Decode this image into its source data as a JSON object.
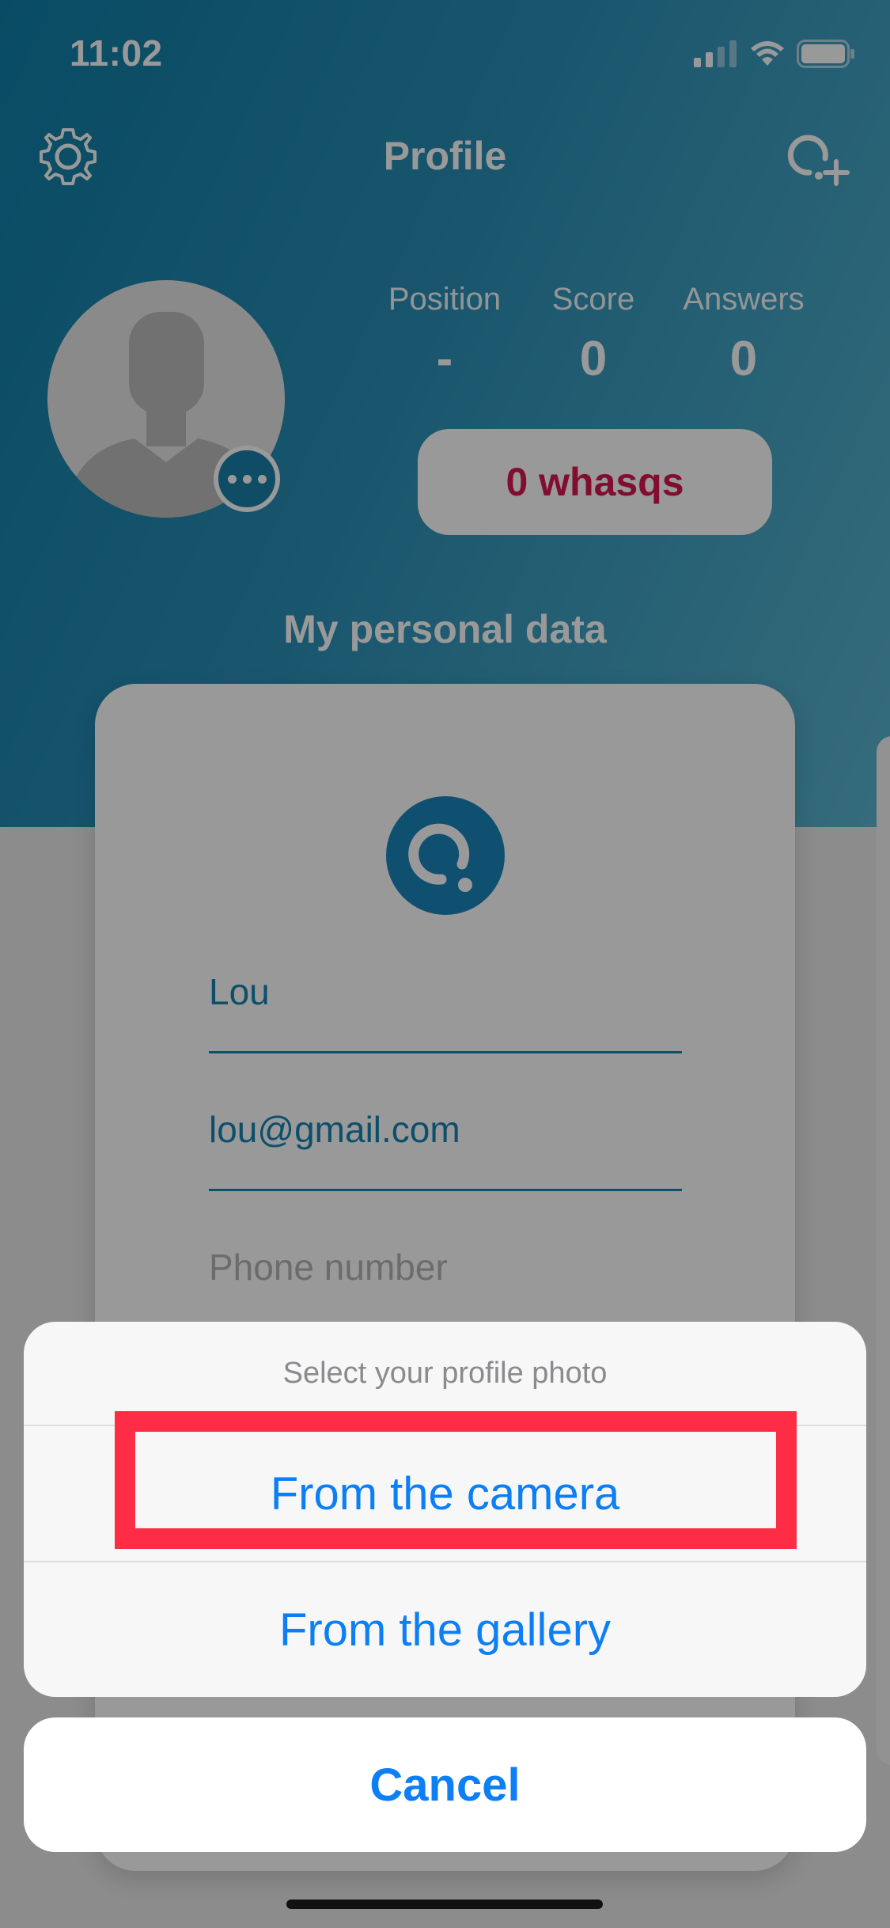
{
  "status_bar": {
    "time": "11:02"
  },
  "nav": {
    "title": "Profile",
    "settings_icon": "gear-icon",
    "add_icon": "add-question-icon"
  },
  "stats": [
    {
      "label": "Position",
      "value": "-"
    },
    {
      "label": "Score",
      "value": "0"
    },
    {
      "label": "Answers",
      "value": "0"
    }
  ],
  "whasqs_label": "0 whasqs",
  "section_title": "My personal data",
  "form": {
    "name_value": "Lou",
    "email_value": "lou@gmail.com",
    "phone_placeholder": "Phone number"
  },
  "action_sheet": {
    "title": "Select your profile photo",
    "options": [
      "From the camera",
      "From the gallery"
    ],
    "cancel": "Cancel"
  },
  "colors": {
    "accent_blue": "#0d7ff5",
    "brand_teal": "#1684b3",
    "whasqs_red": "#d8174f",
    "highlight_red": "#fe2c44"
  }
}
